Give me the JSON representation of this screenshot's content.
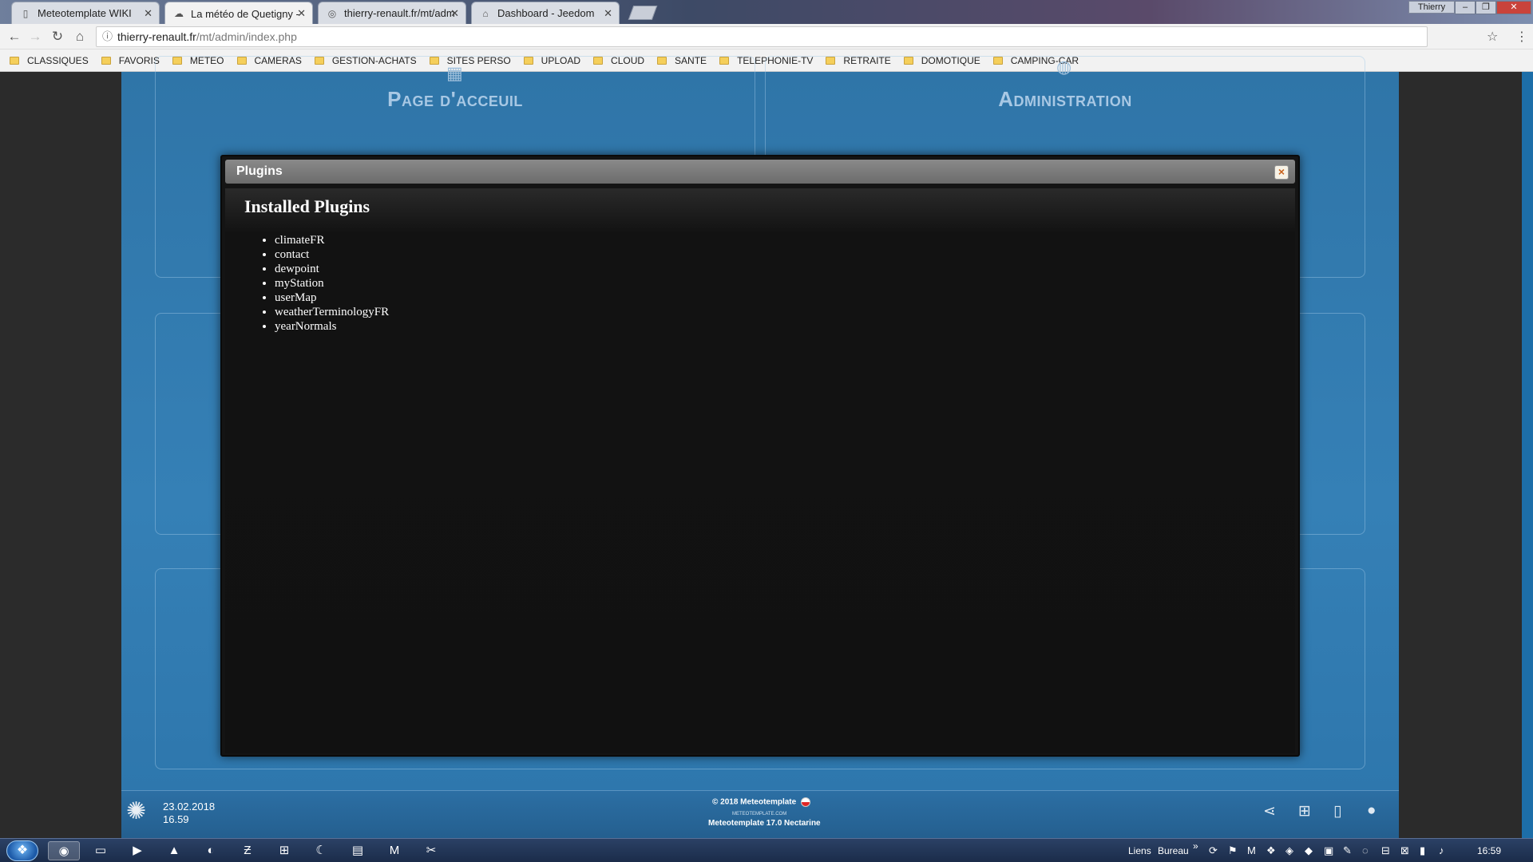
{
  "browser": {
    "tabs": [
      {
        "label": "Meteotemplate WIKI",
        "icon": "page-icon",
        "active": false
      },
      {
        "label": "La météo de Quetigny - ",
        "icon": "weather-icon",
        "active": true
      },
      {
        "label": "thierry-renault.fr/mt/adm",
        "icon": "globe-icon",
        "active": false
      },
      {
        "label": "Dashboard - Jeedom",
        "icon": "home-icon",
        "active": false
      }
    ],
    "window_user": "Thierry",
    "url_host": "thierry-renault.fr",
    "url_path": "/mt/admin/index.php",
    "bookmarks": [
      "CLASSIQUES",
      "FAVORIS",
      "METEO",
      "CAMERAS",
      "GESTION-ACHATS",
      "SITES PERSO",
      "UPLOAD",
      "CLOUD",
      "SANTE",
      "TELEPHONIE-TV",
      "RETRAITE",
      "DOMOTIQUE",
      "CAMPING-CAR"
    ]
  },
  "site": {
    "panel_home_title": "Page d'acceuil",
    "panel_admin_title": "Administration",
    "footer": {
      "date": "23.02.2018",
      "time": "16.59",
      "copyright": "© 2018  Meteotemplate",
      "site": "METEOTEMPLATE.COM",
      "version": "Meteotemplate 17.0 Nectarine"
    }
  },
  "modal": {
    "title": "Plugins",
    "close_label": "×",
    "heading": "Installed Plugins",
    "plugins": [
      "climateFR",
      "contact",
      "dewpoint",
      "myStation",
      "userMap",
      "weatherTerminologyFR",
      "yearNormals"
    ]
  },
  "taskbar": {
    "links_label": "Liens",
    "desktop_label": "Bureau",
    "clock": "16:59"
  },
  "colors": {
    "site_blue": "#3580b6",
    "modal_bg": "#141414",
    "close_x": "#c8601a"
  }
}
